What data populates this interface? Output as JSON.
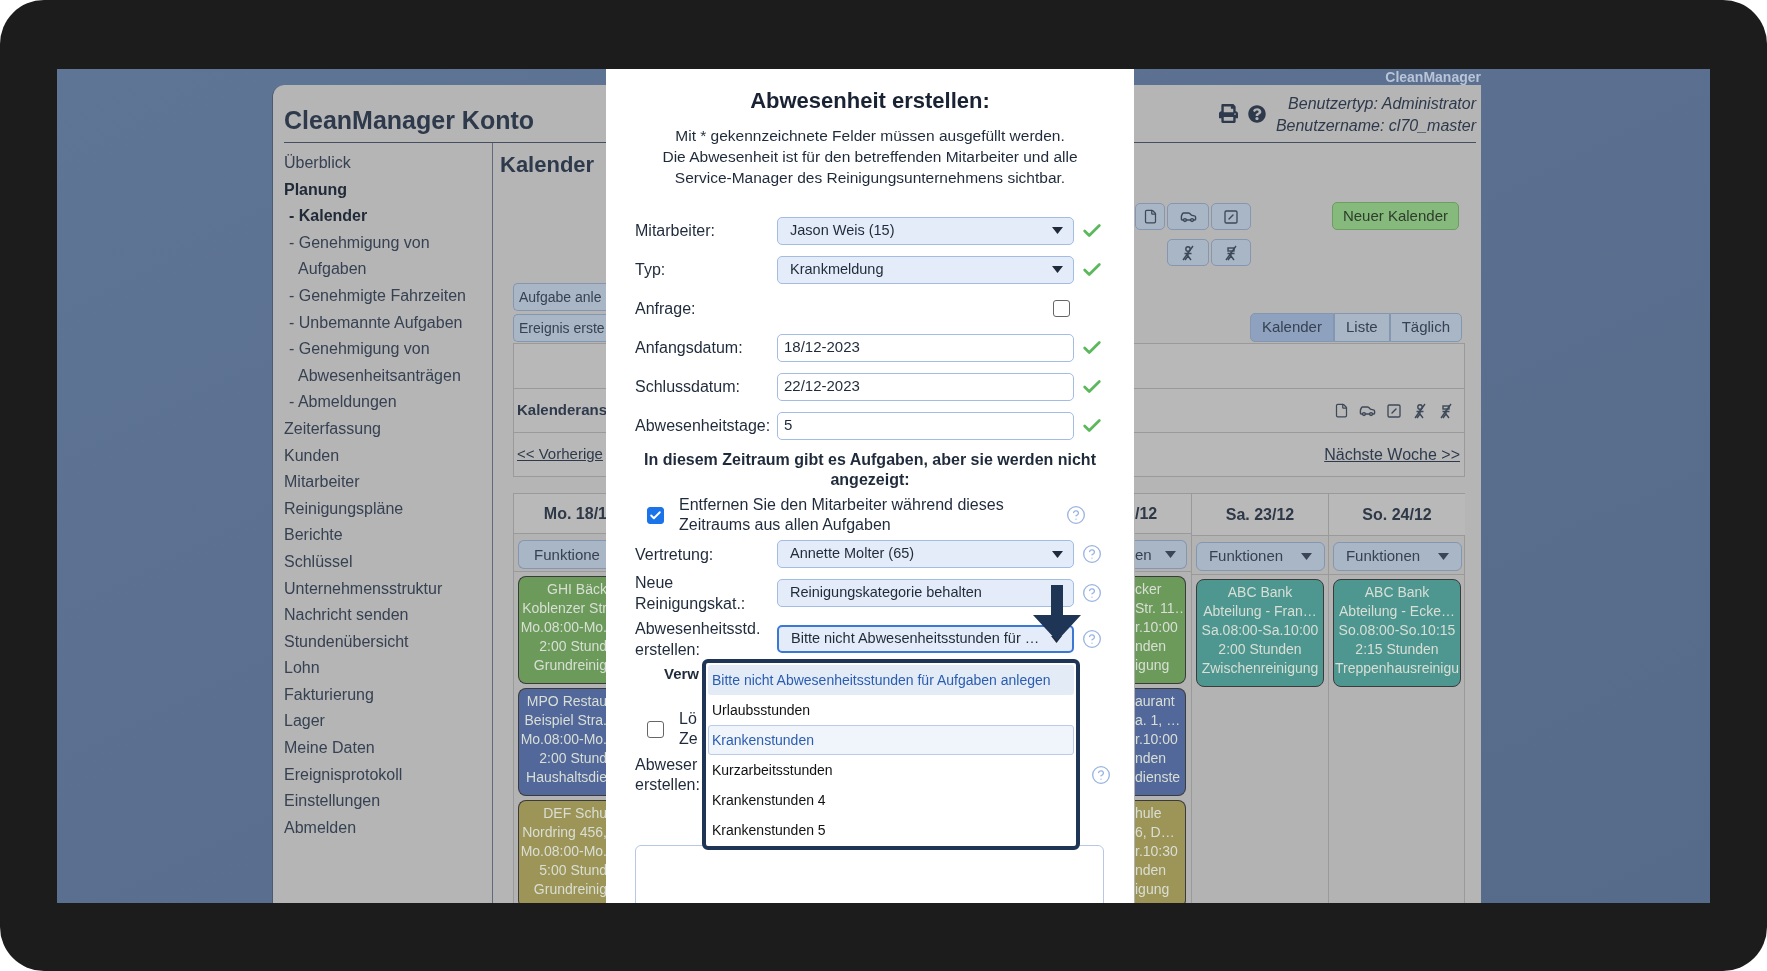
{
  "brand": "CleanManager",
  "account_title": "CleanManager Konto",
  "user_info": [
    "Benutzertyp: Administrator",
    "Benutzername: cl70_master"
  ],
  "sidebar": {
    "items": [
      {
        "label": "Überblick",
        "selected": false
      },
      {
        "label": "Planung",
        "selected": true,
        "children": [
          {
            "label": "- Kalender",
            "selected": true
          },
          {
            "label": "- Genehmigung von Aufgaben",
            "selected": false
          },
          {
            "label": "- Genehmigte Fahrzeiten",
            "selected": false
          },
          {
            "label": "- Unbemannte Aufgaben",
            "selected": false
          },
          {
            "label": "- Genehmigung von Abwesenheitsanträgen",
            "selected": false
          },
          {
            "label": "- Abmeldungen",
            "selected": false
          }
        ]
      },
      {
        "label": "Zeiterfassung",
        "selected": false
      },
      {
        "label": "Kunden",
        "selected": false
      },
      {
        "label": "Mitarbeiter",
        "selected": false
      },
      {
        "label": "Reinigungspläne",
        "selected": false
      },
      {
        "label": "Berichte",
        "selected": false
      },
      {
        "label": "Schlüssel",
        "selected": false
      },
      {
        "label": "Unternehmensstruktur",
        "selected": false
      },
      {
        "label": "Nachricht senden",
        "selected": false
      },
      {
        "label": "Stundenübersicht",
        "selected": false
      },
      {
        "label": "Lohn",
        "selected": false
      },
      {
        "label": "Fakturierung",
        "selected": false
      },
      {
        "label": "Lager",
        "selected": false
      },
      {
        "label": "Meine Daten",
        "selected": false
      },
      {
        "label": "Ereignisprotokoll",
        "selected": false
      },
      {
        "label": "Einstellungen",
        "selected": false
      },
      {
        "label": "Abmelden",
        "selected": false
      }
    ]
  },
  "page_heading": "Kalender",
  "action_buttons": [
    "Aufgabe anle",
    "Ereignis erste"
  ],
  "new_calendar_button": "Neuer Kalender",
  "view_tabs": [
    {
      "label": "Kalender",
      "selected": true
    },
    {
      "label": "Liste",
      "selected": false
    },
    {
      "label": "Täglich",
      "selected": false
    }
  ],
  "calendar_nav": {
    "view_label": "Kalenderans",
    "prev_link": "<< Vorherige",
    "next_link": "Nächste Woche >>"
  },
  "days": [
    {
      "kind": "cut_right",
      "header": "Mo. 18/1",
      "menu": "Funktione",
      "events": [
        {
          "color": "#6b9a5b",
          "lines": [
            "GHI Bäck",
            "Koblenzer Str",
            "Mo.08:00-Mo.",
            "2:00 Stund",
            "Grundreinig"
          ]
        },
        {
          "color": "#52679a",
          "lines": [
            "MPO Restau",
            "Beispiel Stra.",
            "Mo.08:00-Mo.",
            "2:00 Stund",
            "Haushaltsdie"
          ]
        },
        {
          "color": "#9d9457",
          "lines": [
            "DEF Schu",
            "Nordring 456,",
            "Mo.08:00-Mo.",
            "5:00 Stund",
            "Grundreinig"
          ]
        }
      ]
    },
    {
      "kind": "cut_left",
      "header": "/12",
      "menu": "en",
      "events": [
        {
          "color": "#6b9a5b",
          "lines": [
            "cker",
            "Str. 11…",
            "r.10:00",
            "nden",
            "igung"
          ]
        },
        {
          "color": "#52679a",
          "lines": [
            "aurant",
            "a. 1, …",
            "r.10:00",
            "nden",
            "dienste"
          ]
        },
        {
          "color": "#9d9457",
          "lines": [
            "hule",
            "6, D…",
            "r.10:30",
            "nden",
            "igung"
          ]
        }
      ]
    },
    {
      "kind": "full",
      "header": "Sa. 23/12",
      "menu": "Funktionen",
      "events": [
        {
          "color": "#4e9690",
          "lines": [
            "ABC Bank",
            "Abteilung - Fran…",
            "Sa.08:00-Sa.10:00",
            "2:00 Stunden",
            "Zwischenreinigung"
          ]
        }
      ]
    },
    {
      "kind": "full",
      "header": "So. 24/12",
      "menu": "Funktionen",
      "events": [
        {
          "color": "#4e9690",
          "lines": [
            "ABC Bank",
            "Abteilung - Ecke…",
            "So.08:00-So.10:15",
            "2:15 Stunden",
            "Treppenhausreinigu"
          ]
        }
      ]
    }
  ],
  "dialog": {
    "title": "Abwesenheit erstellen:",
    "intro": [
      "Mit * gekennzeichnete Felder müssen ausgefüllt werden.",
      "Die Abwesenheit ist für den betreffenden Mitarbeiter und alle",
      "Service-Manager des Reinigungsunternehmens sichtbar."
    ],
    "fields": [
      {
        "kind": "select",
        "label": "Mitarbeiter:",
        "value": "Jason Weis (15)",
        "valid": true
      },
      {
        "kind": "select",
        "label": "Typ:",
        "value": "Krankmeldung",
        "valid": true
      },
      {
        "kind": "checkbox",
        "label": "Anfrage:",
        "checked": false
      },
      {
        "kind": "text",
        "label": "Anfangsdatum:",
        "value": "18/12-2023",
        "valid": true
      },
      {
        "kind": "text",
        "label": "Schlussdatum:",
        "value": "22/12-2023",
        "valid": true
      },
      {
        "kind": "text",
        "label": "Abwesenheitstage:",
        "value": "5",
        "valid": true
      }
    ],
    "notice": "In diesem Zeitraum gibt es Aufgaben, aber sie werden nicht angezeigt:",
    "remove_option": {
      "label": "Entfernen Sie den Mitarbeiter während dieses Zeitraums aus allen Aufgaben",
      "checked": true
    },
    "task_fields": [
      {
        "kind": "select",
        "label": "Vertretung:",
        "value": "Annette Molter (65)",
        "focused": false
      },
      {
        "kind": "plain",
        "label": "Neue Reinigungskat.:",
        "value": "Reinigungskategorie behalten",
        "focused": false
      },
      {
        "kind": "select",
        "label": "Abwesenheitsstd. erstellen:",
        "value": "Bitte nicht Abwesenheitsstunden für …",
        "focused": true
      }
    ],
    "covered": {
      "heading": "Verw",
      "option_lines": [
        "Lö",
        "Ze"
      ],
      "option_checked": false,
      "label_lines": [
        "Abweser",
        "erstellen:"
      ]
    },
    "options": [
      {
        "label": "Bitte nicht Abwesenheitsstunden für Aufgaben anlegen",
        "selected": true,
        "hovered": false
      },
      {
        "label": "Urlaubsstunden",
        "selected": false,
        "hovered": false
      },
      {
        "label": "Krankenstunden",
        "selected": false,
        "hovered": true
      },
      {
        "label": "Kurzarbeitsstunden",
        "selected": false,
        "hovered": false
      },
      {
        "label": "Krankenstunden 4",
        "selected": false,
        "hovered": false
      },
      {
        "label": "Krankenstunden 5",
        "selected": false,
        "hovered": false
      }
    ]
  }
}
